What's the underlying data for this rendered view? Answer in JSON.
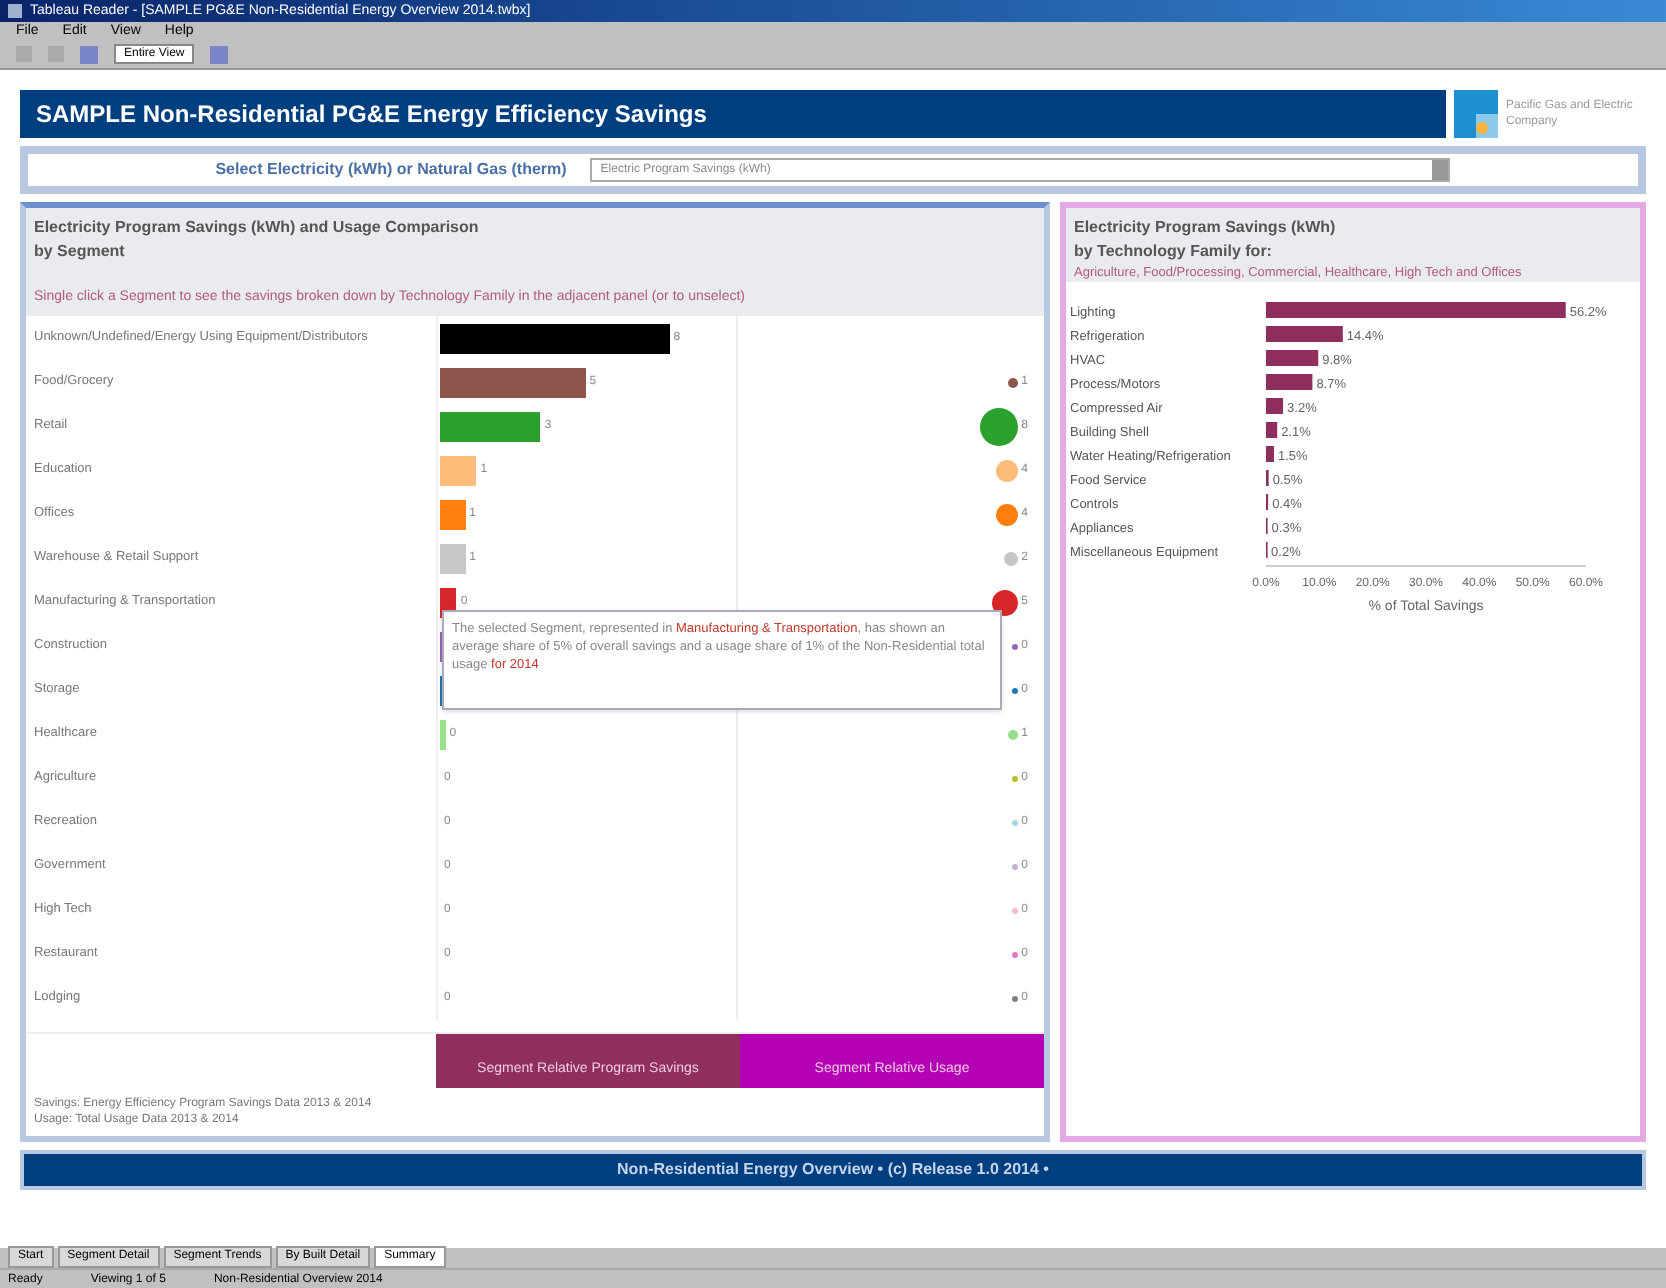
{
  "window": {
    "title": "Tableau Reader - [SAMPLE PG&E Non-Residential Energy Overview 2014.twbx]"
  },
  "menu": [
    "File",
    "Edit",
    "View",
    "Help"
  ],
  "toolbar": {
    "zoom": "Entire View"
  },
  "header": {
    "title": "SAMPLE Non-Residential PG&E Energy Efficiency Savings",
    "logo_text": "Pacific Gas and Electric Company"
  },
  "selector": {
    "label": "Select Electricity (kWh) or Natural Gas (therm)",
    "value": "Electric Program Savings (kWh)"
  },
  "segments_panel": {
    "title": "Electricity Program Savings (kWh) and Usage Comparison",
    "subtitle": "by Segment",
    "note": "Single click a Segment to see the savings broken down by Technology Family in the adjacent panel (or to unselect)",
    "rows": [
      {
        "name": "Unknown/Undefined/Energy Using Equipment/Distributors",
        "color": "#000000",
        "savings": {
          "value": "8",
          "level": 0.82
        }
      },
      {
        "name": "Food/Grocery",
        "color": "#8c564b",
        "savings": {
          "value": "5",
          "level": 0.52
        },
        "usage": "1"
      },
      {
        "name": "Retail",
        "color": "#2ca02c",
        "savings": {
          "value": "3",
          "level": 0.36
        },
        "usage": "8"
      },
      {
        "name": "Education",
        "color": "#ffbb78",
        "savings": {
          "value": "1",
          "level": 0.13
        },
        "usage": "4"
      },
      {
        "name": "Offices",
        "color": "#ff7f0e",
        "savings": {
          "value": "1",
          "level": 0.09
        },
        "usage": "4"
      },
      {
        "name": "Warehouse & Retail Support",
        "color": "#c7c7c7",
        "savings": {
          "value": "1",
          "level": 0.09
        },
        "usage": "2"
      },
      {
        "name": "Manufacturing & Transportation",
        "color": "#d62728",
        "savings": {
          "value": "0",
          "level": 0.06
        },
        "usage": "5"
      },
      {
        "name": "Construction",
        "color": "#9467bd",
        "savings": {
          "level": 0.02
        },
        "usage": "0"
      },
      {
        "name": "Storage",
        "color": "#1f77b4",
        "savings": {
          "level": 0.02
        },
        "usage": "0"
      },
      {
        "name": "Healthcare",
        "color": "#98df8a",
        "savings": {
          "value": "0",
          "level": 0.02
        },
        "usage": "1"
      },
      {
        "name": "Agriculture",
        "color": "#bcbd22",
        "savings": {
          "value": "0"
        },
        "usage": "0"
      },
      {
        "name": "Recreation",
        "color": "#9edae5",
        "savings": {
          "value": "0"
        },
        "usage": "0"
      },
      {
        "name": "Government",
        "color": "#c5b0d5",
        "savings": {
          "value": "0"
        },
        "usage": "0"
      },
      {
        "name": "High Tech",
        "color": "#f7b6d2",
        "savings": {
          "value": "0"
        },
        "usage": "0"
      },
      {
        "name": "Restaurant",
        "color": "#e377c2",
        "savings": {
          "value": "0"
        },
        "usage": "0"
      },
      {
        "name": "Lodging",
        "color": "#7f7f7f",
        "savings": {
          "value": "0"
        },
        "usage": "0"
      }
    ],
    "tooltip": [
      {
        "text": "The selected Segment, represented in ",
        "kind": "plain"
      },
      {
        "text": "Manufacturing & Transportation",
        "kind": "highlight"
      },
      {
        "text": ", has shown an average share of 5% of overall savings and a usage share of 1% of the Non-Residential total usage",
        "kind": "plain"
      },
      {
        "text": " for 2014",
        "kind": "highlight"
      }
    ],
    "buttons": [
      {
        "label": "Segment Relative Program Savings",
        "selected": false
      },
      {
        "label": "Segment Relative Usage",
        "selected": true
      }
    ],
    "sources": [
      "Savings: Energy Efficiency Program Savings Data 2013 & 2014",
      "Usage: Total Usage Data 2013 & 2014"
    ]
  },
  "technology_panel": {
    "title": "Electricity Program Savings (kWh)",
    "subtitle": "by Technology Family for:",
    "selection": "Agriculture, Food/Processing, Commercial, Healthcare, High Tech and Offices",
    "chart_data": {
      "type": "bar",
      "orientation": "horizontal",
      "xlabel": "% of Total Savings",
      "categories": [
        "Lighting",
        "Refrigeration",
        "HVAC",
        "Process/Motors",
        "Compressed Air",
        "Building Shell",
        "Water Heating/Refrigeration",
        "Food Service",
        "Controls",
        "Appliances",
        "Miscellaneous Equipment"
      ],
      "series": [
        {
          "color": "#8e2f5e",
          "values": [
            56.2,
            14.4,
            9.8,
            8.7,
            3.2,
            2.1,
            1.5,
            0.5,
            0.4,
            0.3,
            0.2
          ]
        }
      ],
      "value_labels": [
        "56.2%",
        "14.4%",
        "9.8%",
        "8.7%",
        "3.2%",
        "2.1%",
        "1.5%",
        "0.5%",
        "0.4%",
        "0.3%",
        "0.2%"
      ],
      "xticks": [
        {
          "value": 0,
          "label": "0.0%"
        },
        {
          "value": 10,
          "label": "10.0%"
        },
        {
          "value": 20,
          "label": "20.0%"
        },
        {
          "value": 30,
          "label": "30.0%"
        },
        {
          "value": 40,
          "label": "40.0%"
        },
        {
          "value": 50,
          "label": "50.0%"
        },
        {
          "value": 60,
          "label": "60.0%"
        }
      ],
      "xlim": [
        0,
        60
      ]
    }
  },
  "footer": "Non-Residential Energy Overview • (c) Release 1.0 2014 •",
  "sheet_tabs": [
    {
      "label": "Start",
      "selected": false
    },
    {
      "label": "Segment Detail",
      "selected": false
    },
    {
      "label": "Segment Trends",
      "selected": false
    },
    {
      "label": "By Built Detail",
      "selected": false
    },
    {
      "label": "Summary",
      "selected": true
    }
  ],
  "status_bar": [
    "Ready",
    "Viewing 1 of 5",
    "Non-Residential Overview 2014"
  ]
}
